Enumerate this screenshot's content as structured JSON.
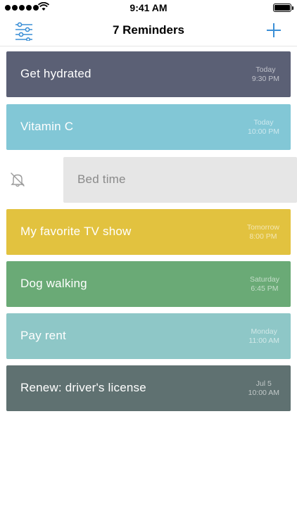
{
  "status": {
    "time": "9:41 AM"
  },
  "nav": {
    "title": "7 Reminders",
    "left_icon": "filter-sliders-icon",
    "right_icon": "plus-icon",
    "accent": "#3b8fd6"
  },
  "reminders": [
    {
      "title": "Get hydrated",
      "day": "Today",
      "time": "9:30 PM",
      "color": "#5b6075"
    },
    {
      "title": "Vitamin C",
      "day": "Today",
      "time": "10:00 PM",
      "color": "#82c7d6"
    },
    {
      "title": "Bed time",
      "day": "",
      "time": "",
      "color": "#e6e6e6",
      "swiped": true,
      "action_icon": "bell-off-icon"
    },
    {
      "title": "My favorite TV show",
      "day": "Tomorrow",
      "time": "8:00 PM",
      "color": "#e2c23f"
    },
    {
      "title": "Dog walking",
      "day": "Saturday",
      "time": "6:45 PM",
      "color": "#6aaa76"
    },
    {
      "title": "Pay rent",
      "day": "Monday",
      "time": "11:00 AM",
      "color": "#8ec7c7"
    },
    {
      "title": "Renew: driver's license",
      "day": "Jul 5",
      "time": "10:00 AM",
      "color": "#5f7171"
    }
  ]
}
